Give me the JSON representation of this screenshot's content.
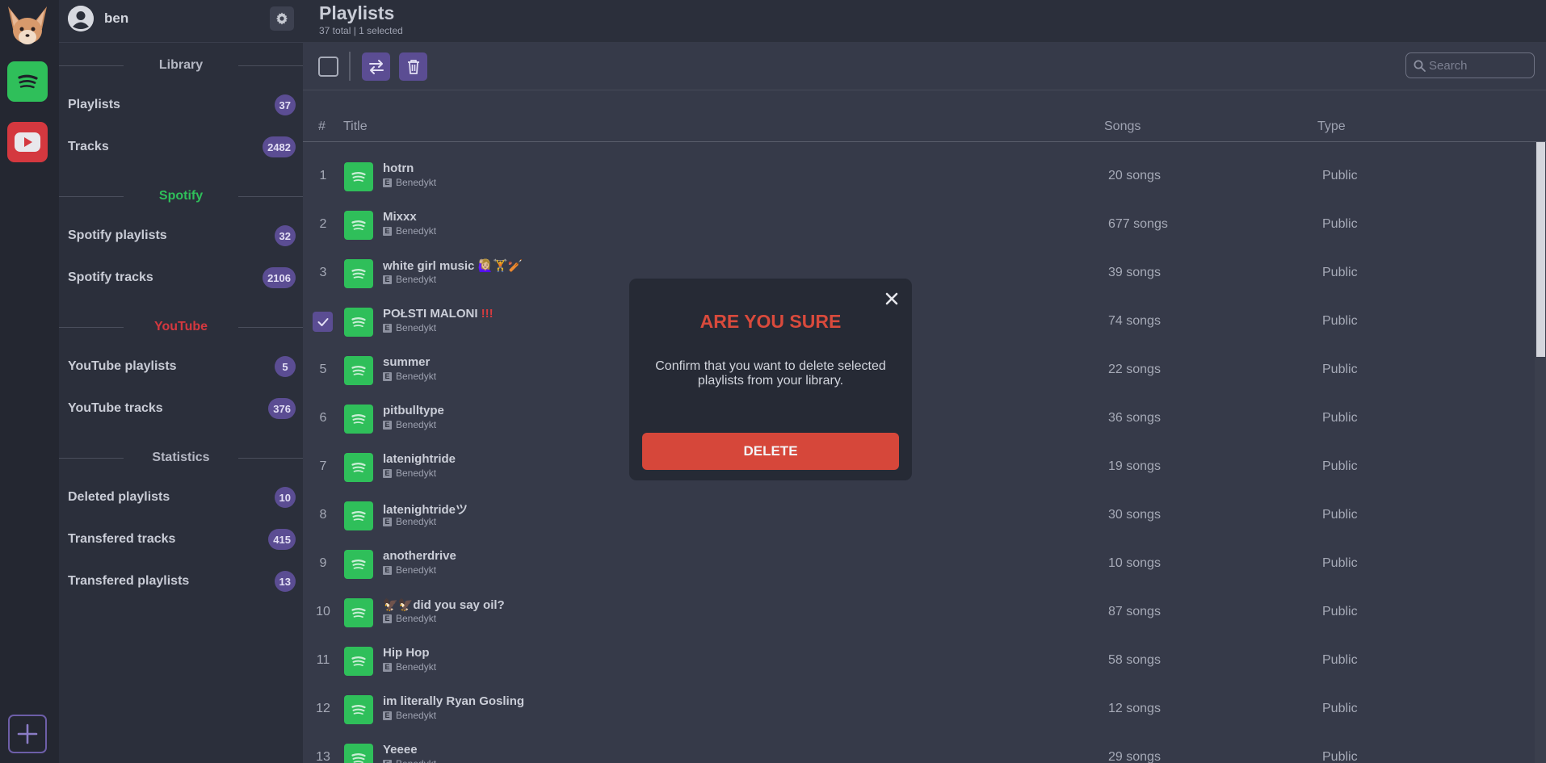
{
  "user": {
    "name": "ben"
  },
  "sidebar": {
    "sections": {
      "library": {
        "title": "Library",
        "color": "#b4b7c3"
      },
      "spotify": {
        "title": "Spotify",
        "color": "#2fbf5a"
      },
      "youtube": {
        "title": "YouTube",
        "color": "#d4383f"
      },
      "statistics": {
        "title": "Statistics",
        "color": "#b4b7c3"
      }
    },
    "items": [
      {
        "label": "Playlists",
        "count": "37"
      },
      {
        "label": "Tracks",
        "count": "2482"
      },
      {
        "label": "Spotify playlists",
        "count": "32"
      },
      {
        "label": "Spotify tracks",
        "count": "2106"
      },
      {
        "label": "YouTube playlists",
        "count": "5"
      },
      {
        "label": "YouTube tracks",
        "count": "376"
      },
      {
        "label": "Deleted playlists",
        "count": "10"
      },
      {
        "label": "Transfered tracks",
        "count": "415"
      },
      {
        "label": "Transfered playlists",
        "count": "13"
      }
    ]
  },
  "header": {
    "title": "Playlists",
    "subtitle": "37 total | 1 selected"
  },
  "search": {
    "placeholder": "Search",
    "value": ""
  },
  "table": {
    "columns": {
      "num": "#",
      "title": "Title",
      "songs": "Songs",
      "type": "Type"
    },
    "rows": [
      {
        "num": "1",
        "title": "hotrn",
        "title_extra": "",
        "owner": "Benedykt",
        "songs": "20 songs",
        "type": "Public",
        "selected": false
      },
      {
        "num": "2",
        "title": "Mixxx",
        "title_extra": "",
        "owner": "Benedykt",
        "songs": "677 songs",
        "type": "Public",
        "selected": false
      },
      {
        "num": "3",
        "title": "white girl music 🙋🏼‍♀️🏋️🏏",
        "title_extra": "",
        "owner": "Benedykt",
        "songs": "39 songs",
        "type": "Public",
        "selected": false
      },
      {
        "num": "4",
        "title": "POŁSTI MALONI",
        "title_extra": "!!!",
        "owner": "Benedykt",
        "songs": "74 songs",
        "type": "Public",
        "selected": true
      },
      {
        "num": "5",
        "title": "summer",
        "title_extra": "",
        "owner": "Benedykt",
        "songs": "22 songs",
        "type": "Public",
        "selected": false
      },
      {
        "num": "6",
        "title": "pitbulltype",
        "title_extra": "",
        "owner": "Benedykt",
        "songs": "36 songs",
        "type": "Public",
        "selected": false
      },
      {
        "num": "7",
        "title": "latenightride",
        "title_extra": "",
        "owner": "Benedykt",
        "songs": "19 songs",
        "type": "Public",
        "selected": false
      },
      {
        "num": "8",
        "title": "latenightrideツ",
        "title_extra": "",
        "owner": "Benedykt",
        "songs": "30 songs",
        "type": "Public",
        "selected": false
      },
      {
        "num": "9",
        "title": "anotherdrive",
        "title_extra": "",
        "owner": "Benedykt",
        "songs": "10 songs",
        "type": "Public",
        "selected": false
      },
      {
        "num": "10",
        "title": "🦅🦅did you say oil?",
        "title_extra": "",
        "owner": "Benedykt",
        "songs": "87 songs",
        "type": "Public",
        "selected": false
      },
      {
        "num": "11",
        "title": "Hip Hop",
        "title_extra": "",
        "owner": "Benedykt",
        "songs": "58 songs",
        "type": "Public",
        "selected": false
      },
      {
        "num": "12",
        "title": "im literally Ryan Gosling",
        "title_extra": "",
        "owner": "Benedykt",
        "songs": "12 songs",
        "type": "Public",
        "selected": false
      },
      {
        "num": "13",
        "title": "Yeeee",
        "title_extra": "",
        "owner": "Benedykt",
        "songs": "29 songs",
        "type": "Public",
        "selected": false
      }
    ]
  },
  "modal": {
    "title": "ARE YOU SURE",
    "text": "Confirm that you want to delete selected playlists from your library.",
    "button": "DELETE"
  },
  "colors": {
    "accent": "#5b4d93",
    "spotify": "#2fbf5a",
    "youtube": "#d4383f",
    "danger": "#d6473a"
  },
  "icons": {
    "logo": "fox-logo-icon",
    "spotify": "spotify-icon",
    "youtube": "youtube-icon",
    "add": "plus-icon",
    "settings": "gear-icon",
    "transfer": "transfer-arrows-icon",
    "delete": "trash-icon",
    "search": "search-icon",
    "close": "close-icon",
    "check": "checkmark-icon"
  }
}
